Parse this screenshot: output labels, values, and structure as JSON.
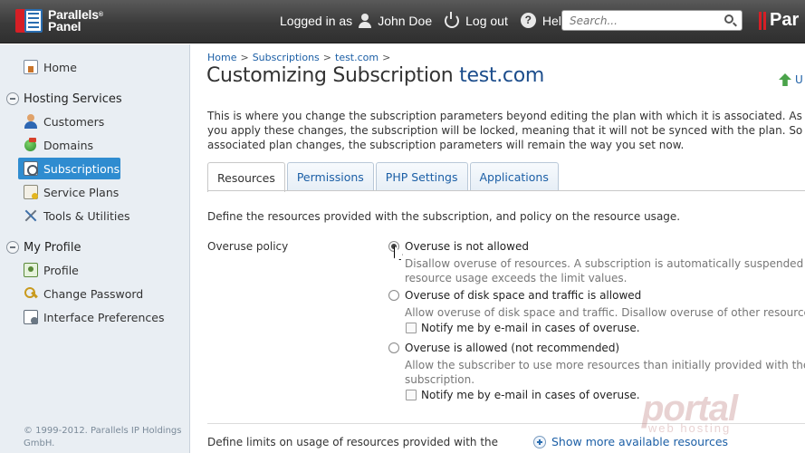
{
  "brand": {
    "logo_line1": "Parallels",
    "logo_line2": "Panel",
    "trademark": "®",
    "right_brand": "Par"
  },
  "user_nav": {
    "logged_in_as": "Logged in as",
    "user_name": "John Doe",
    "logout": "Log out",
    "help": "Help"
  },
  "search": {
    "placeholder": "Search..."
  },
  "sidebar": {
    "home": "Home",
    "hosting_services": {
      "title": "Hosting Services",
      "items": [
        {
          "label": "Customers",
          "icon": "customers-icon"
        },
        {
          "label": "Domains",
          "icon": "domains-icon"
        },
        {
          "label": "Subscriptions",
          "icon": "subscriptions-icon",
          "active": true
        },
        {
          "label": "Service Plans",
          "icon": "service-plans-icon"
        },
        {
          "label": "Tools & Utilities",
          "icon": "tools-icon"
        }
      ]
    },
    "my_profile": {
      "title": "My Profile",
      "items": [
        {
          "label": "Profile",
          "icon": "profile-icon"
        },
        {
          "label": "Change Password",
          "icon": "password-icon"
        },
        {
          "label": "Interface Preferences",
          "icon": "interface-preferences-icon"
        }
      ]
    },
    "copyright": "© 1999-2012. Parallels IP Holdings GmbH."
  },
  "breadcrumb": [
    "Home",
    "Subscriptions",
    "test.com"
  ],
  "breadcrumb_separator": ">",
  "page": {
    "title_prefix": "Customizing Subscription",
    "title_domain": "test.com",
    "up_link": "U",
    "intro_lines": [
      "This is where you change the subscription parameters beyond editing the plan with which it is associated. As soo",
      "you apply these changes, the subscription will be locked, meaning that it will not be synced with the plan. So whe",
      "associated plan changes, the subscription parameters will remain the way you set now."
    ]
  },
  "tabs": [
    {
      "label": "Resources",
      "active": true
    },
    {
      "label": "Permissions",
      "active": false
    },
    {
      "label": "PHP Settings",
      "active": false
    },
    {
      "label": "Applications",
      "active": false
    }
  ],
  "resources": {
    "description": "Define the resources provided with the subscription, and policy on the resource usage.",
    "overuse_label": "Overuse policy",
    "options": [
      {
        "label": "Overuse is not allowed",
        "checked": true,
        "desc_lines": [
          "Disallow overuse of resources. A subscription is automatically suspended if",
          "resource usage exceeds the limit values."
        ],
        "notify": null
      },
      {
        "label": "Overuse of disk space and traffic is allowed",
        "checked": false,
        "desc_lines": [
          "Allow overuse of disk space and traffic. Disallow overuse of other resources"
        ],
        "notify": "Notify me by e-mail in cases of overuse."
      },
      {
        "label": "Overuse is allowed (not recommended)",
        "checked": false,
        "desc_lines": [
          "Allow the subscriber to use more resources than initially provided with the",
          "subscription."
        ],
        "notify": "Notify me by e-mail in cases of overuse."
      }
    ],
    "limits_desc": "Define limits on usage of resources provided with the",
    "show_more": "Show more available resources"
  },
  "watermark": {
    "main": "portal",
    "sub": "web hosting"
  },
  "colors": {
    "accent": "#2f8cd0",
    "link": "#1c5fa6",
    "title_accent": "#1c4d8c",
    "topbar": "#3b3b3b",
    "sidebar": "#e9eef3"
  }
}
